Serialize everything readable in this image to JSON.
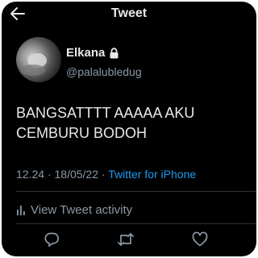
{
  "header": {
    "title": "Tweet",
    "back_icon": "arrow-left-icon"
  },
  "author": {
    "display_name": "Elkana",
    "handle": "@palalubledug",
    "protected_icon": "lock-icon"
  },
  "tweet": {
    "text_line1": "BANGSATTTT AAAAA AKU",
    "text_line2": "CEMBURU BODOH",
    "time": "12.24",
    "separator": " · ",
    "date": "18/05/22",
    "source": "Twitter for iPhone"
  },
  "activity": {
    "label": "View Tweet activity",
    "icon": "bar-chart-icon"
  },
  "actions": [
    {
      "name": "reply",
      "icon": "reply-icon"
    },
    {
      "name": "retweet",
      "icon": "retweet-icon"
    },
    {
      "name": "like",
      "icon": "heart-icon"
    }
  ],
  "colors": {
    "background": "#000000",
    "text": "#e7e9ea",
    "secondary": "#8b98a5",
    "accent": "#1d9bf0",
    "divider": "#2f3336"
  }
}
